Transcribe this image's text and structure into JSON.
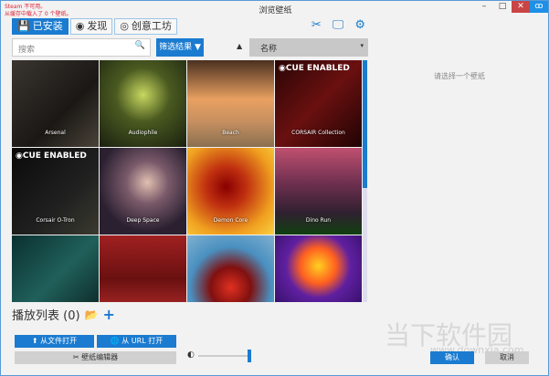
{
  "status": {
    "line1": "Steam 不可用。",
    "line2": "从缓存中载入了 0 个壁纸。"
  },
  "window": {
    "title": "浏览壁纸",
    "minimize": "–",
    "maximize": "□",
    "close": "✕",
    "badge": "ꝏ"
  },
  "tabs": [
    {
      "label": "已安装",
      "icon": "💾"
    },
    {
      "label": "发现",
      "icon": "◉"
    },
    {
      "label": "创意工坊",
      "icon": "◎"
    }
  ],
  "toolbar_icons": {
    "editor": "✂",
    "display": "🖵",
    "settings": "⚙"
  },
  "search": {
    "placeholder": "搜索",
    "icon": "🔍"
  },
  "filter": {
    "label": "筛选结果 ▼"
  },
  "sort": {
    "direction": "▲",
    "value": "名称",
    "dropdown": "▾"
  },
  "wallpapers": [
    {
      "name": "Arsenal",
      "bg": "linear-gradient(135deg,#3a3530,#1a1815 60%,#4a4238)"
    },
    {
      "name": "Audiophile",
      "bg": "radial-gradient(circle at 50% 40%,#c8d860,#4a5a20 40%,#1a2010)"
    },
    {
      "name": "Beach",
      "bg": "linear-gradient(#4a3020,#e8a060 45%,#c89060 70%,#8a7050)"
    },
    {
      "name": "CORSAIR Collection",
      "bg": "linear-gradient(135deg,#2a0505,#6a1010 50%,#200303)",
      "cue": "◉CUE ENABLED"
    },
    {
      "name": "Corsair O-Tron",
      "bg": "linear-gradient(135deg,#0a0a0a,#202020 60%,#3a3a30)",
      "cue": "◉CUE ENABLED"
    },
    {
      "name": "Deep Space",
      "bg": "radial-gradient(circle at 55% 40%,#e0c0b0,#7a5a6a 30%,#2a2030 70%)"
    },
    {
      "name": "Demon Core",
      "bg": "radial-gradient(circle at 45% 45%,#800,#c03010 30%,#f0a020 70%,#f8d040)"
    },
    {
      "name": "Dino Run",
      "bg": "linear-gradient(#c05070,#703050 40%,#302030 75%,#104010)"
    },
    {
      "name": "",
      "bg": "linear-gradient(135deg,#0a3030,#20605a 50%,#0a2020)"
    },
    {
      "name": "",
      "bg": "linear-gradient(#a02020,#6a1010 50%,#c03030)"
    },
    {
      "name": "",
      "bg": "radial-gradient(circle at 50% 60%,#e03020,#801010 30%,#4a90c0 60%,#80b0d0)"
    },
    {
      "name": "",
      "bg": "radial-gradient(circle at 50% 35%,#ffd020,#ff6020 25%,#6020a0 45%,#200850)"
    }
  ],
  "placeholder": "请选择一个壁纸",
  "playlist": {
    "label": "播放列表 (0)",
    "folder_icon": "📂",
    "add_icon": "+"
  },
  "buttons": {
    "open_file": "⬆ 从文件打开",
    "open_url": "🌐 从 URL 打开",
    "editor": "✂ 壁纸编辑器",
    "confirm": "确认",
    "cancel": "取消"
  },
  "brightness": {
    "icon": "◐",
    "value": 1.0
  },
  "watermark": {
    "text": "当下软件园",
    "url": "www.downxia.com"
  }
}
